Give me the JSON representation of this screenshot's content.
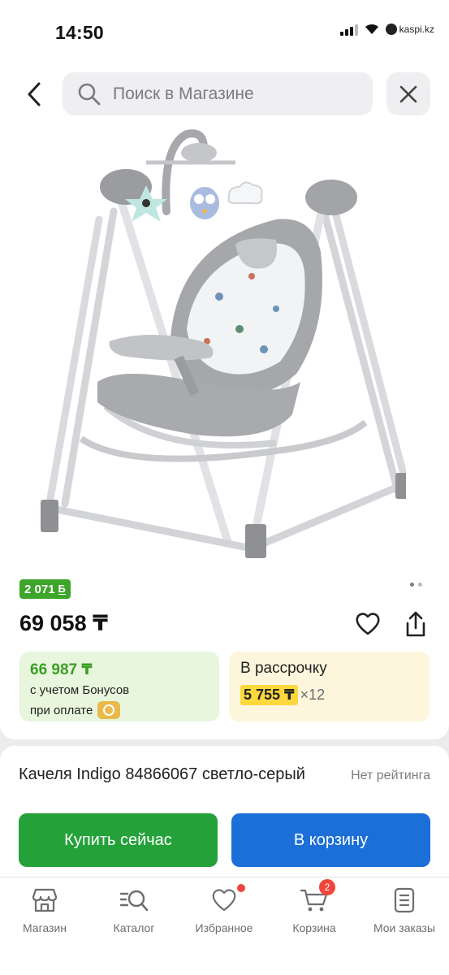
{
  "status_bar": {
    "time": "14:50",
    "carrier": "kaspi.kz"
  },
  "header": {
    "search_placeholder": "Поиск в Магазине"
  },
  "product": {
    "bonus_badge": "2 071",
    "bonus_currency": "Б",
    "image_count": 2,
    "active_image": 1,
    "price": "69 058 ₸",
    "title": "Качеля Indigo 84866067 светло-серый",
    "rating_text": "Нет рейтинга"
  },
  "bonus_offer": {
    "price": "66 987 ₸",
    "line1": "с учетом Бонусов",
    "line2": "при оплате"
  },
  "installment": {
    "label": "В рассрочку",
    "monthly": "5 755 ₸",
    "months": "×12"
  },
  "actions": {
    "buy_now": "Купить сейчас",
    "add_to_cart": "В корзину"
  },
  "tabbar": {
    "items": [
      {
        "label": "Магазин",
        "icon": "store-icon"
      },
      {
        "label": "Каталог",
        "icon": "catalog-search-icon"
      },
      {
        "label": "Избранное",
        "icon": "heart-icon",
        "has_dot": true
      },
      {
        "label": "Корзина",
        "icon": "cart-icon",
        "badge": "2"
      },
      {
        "label": "Мои заказы",
        "icon": "orders-icon"
      }
    ]
  },
  "colors": {
    "bonus_green": "#3da52a",
    "buy_green": "#25a139",
    "cart_blue": "#1b6fd6",
    "installment_yellow": "#fdd83c",
    "badge_red": "#f0453a"
  }
}
